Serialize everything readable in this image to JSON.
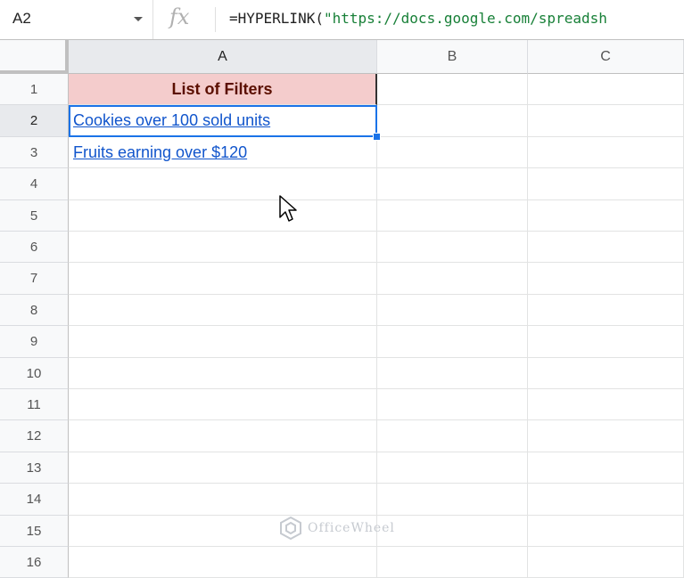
{
  "formula_bar": {
    "name_box": "A2",
    "fx_label": "fx",
    "formula_prefix": "=HYPERLINK(",
    "formula_string": "\"https://docs.google.com/spreadsh"
  },
  "columns": [
    "A",
    "B",
    "C"
  ],
  "rows": [
    "1",
    "2",
    "3",
    "4",
    "5",
    "6",
    "7",
    "8",
    "9",
    "10",
    "11",
    "12",
    "13",
    "14",
    "15",
    "16"
  ],
  "cells": {
    "A1": "List of Filters",
    "A2": "Cookies over 100 sold units",
    "A3": "Fruits earning over $120"
  },
  "selected_cell": "A2",
  "colors": {
    "header_fill": "#f4cccc",
    "header_text": "#5b0f00",
    "link": "#1155cc",
    "selection": "#1a73e8"
  },
  "watermark": "OfficeWheel"
}
